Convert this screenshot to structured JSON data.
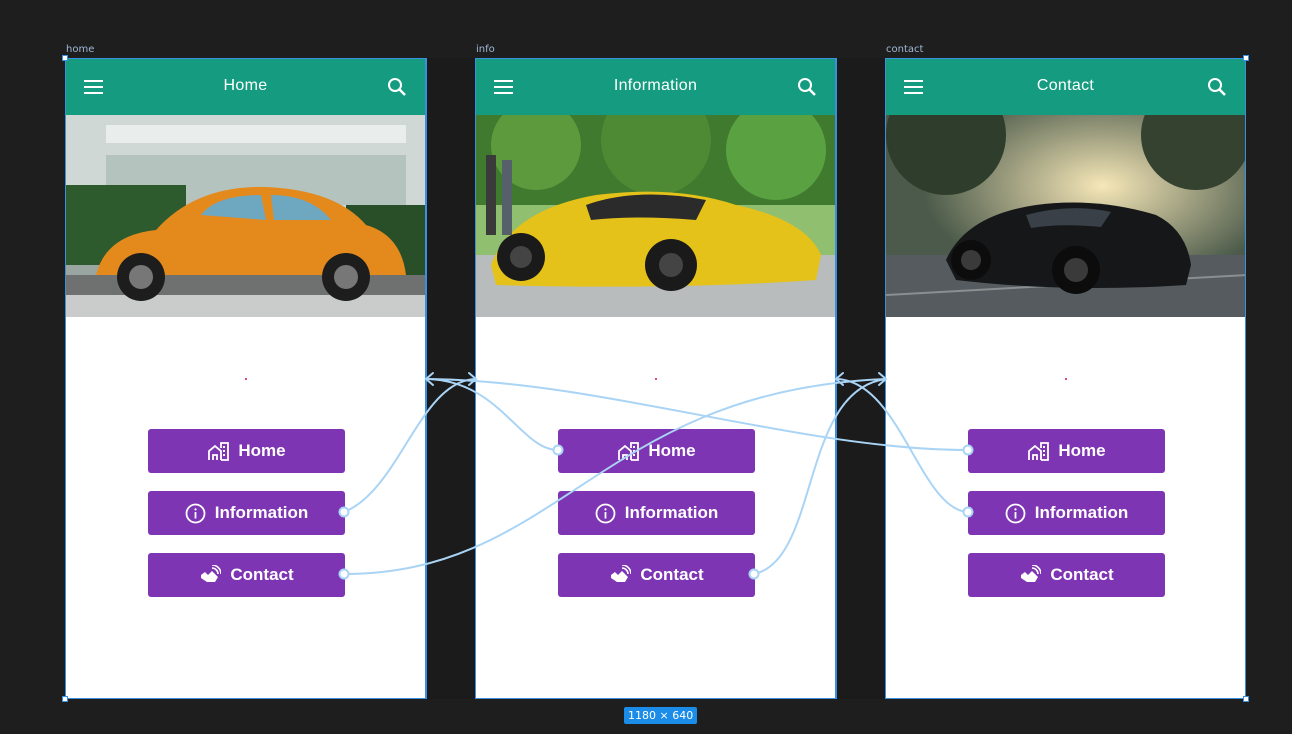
{
  "frames": [
    {
      "label": "home",
      "title": "Home"
    },
    {
      "label": "info",
      "title": "Information"
    },
    {
      "label": "contact",
      "title": "Contact"
    }
  ],
  "buttons": {
    "home": "Home",
    "information": "Information",
    "contact": "Contact"
  },
  "selection_size": "1180 × 640",
  "colors": {
    "appbar": "#159c80",
    "button": "#7e35b4",
    "connector": "#a9d4f5",
    "canvas": "#1e1e1e"
  },
  "icons": {
    "menu": "menu-icon",
    "search": "search-icon",
    "home": "home-city-icon",
    "info": "info-circle-icon",
    "contact": "contactless-icon"
  }
}
